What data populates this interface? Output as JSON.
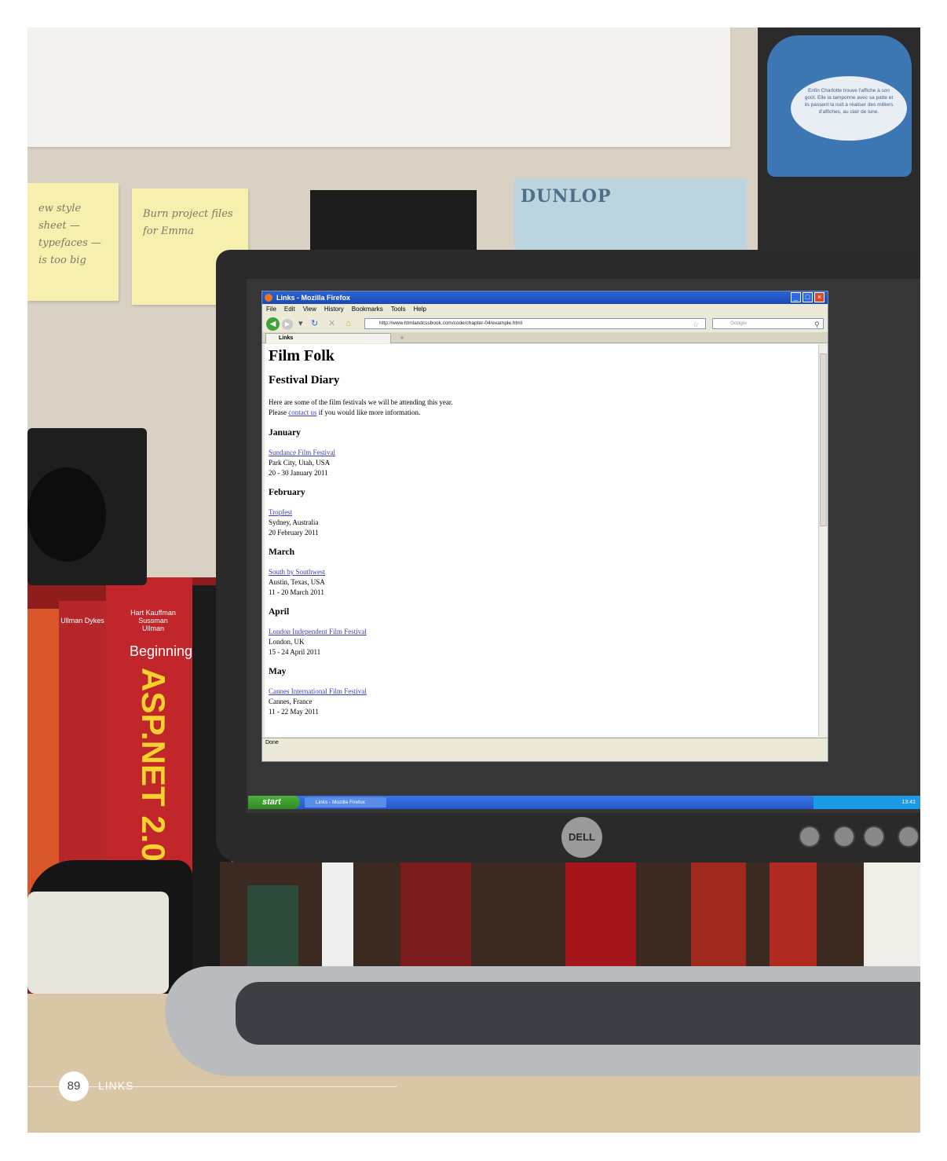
{
  "wall": {
    "sticky_note_1": "ew style sheet — typefaces — is too big",
    "sticky_note_2": "Burn project files for Emma",
    "postcard_brand": "DUNLOP",
    "poster_text": "Enfin Charlotte trouve l'affiche à son goût. Elle la tamponne avec sa patte et ils passent la nuit à réaliser des milliers d'affiches, au clair de lune."
  },
  "books": {
    "authors": "Hart Kauffman Sussman Ullman",
    "title_word": "Beginning",
    "big_title": "ASP.NET 2.0",
    "small_authors": "Ullman Dykes"
  },
  "monitor": {
    "brand": "DELL"
  },
  "browser": {
    "window_title": "Links - Mozilla Firefox",
    "menu": [
      "File",
      "Edit",
      "View",
      "History",
      "Bookmarks",
      "Tools",
      "Help"
    ],
    "url": "http://www.htmlandcssbook.com/code/chapter-04/example.html",
    "search_placeholder": "Google",
    "tab_label": "Links",
    "new_tab": "+",
    "status": "Done"
  },
  "page": {
    "h1": "Film Folk",
    "h2": "Festival Diary",
    "intro_line1": "Here are some of the film festivals we will be attending this year.",
    "intro_before_link": "Please ",
    "intro_link": "contact us",
    "intro_after_link": " if you would like more information.",
    "months": [
      {
        "name": "January",
        "festival": "Sundance Film Festival",
        "location": "Park City, Utah, USA",
        "dates": "20 - 30 January 2011"
      },
      {
        "name": "February",
        "festival": "Tropfest",
        "location": "Sydney, Australia",
        "dates": "20 February 2011"
      },
      {
        "name": "March",
        "festival": "South by Southwest",
        "location": "Austin, Texas, USA",
        "dates": "11 - 20 March 2011"
      },
      {
        "name": "April",
        "festival": "London Independent Film Festival",
        "location": "London, UK",
        "dates": "15 - 24 April 2011"
      },
      {
        "name": "May",
        "festival": "Cannes International Film Festival",
        "location": "Cannes, France",
        "dates": "11 - 22 May 2011"
      }
    ]
  },
  "taskbar": {
    "start_label": "start",
    "task_label": "Links - Mozilla Firefox",
    "clock": "13:41"
  },
  "footer": {
    "page_number": "89",
    "section": "LINKS"
  }
}
